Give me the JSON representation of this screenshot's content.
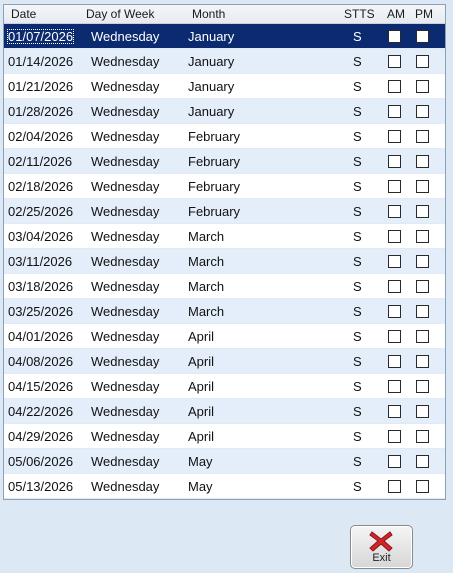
{
  "columns": {
    "date": "Date",
    "day_of_week": "Day of Week",
    "month": "Month",
    "stts": "STTS",
    "am": "AM",
    "pm": "PM"
  },
  "rows": [
    {
      "date": "01/07/2026",
      "day": "Wednesday",
      "month": "January",
      "stts": "S",
      "am": false,
      "pm": false,
      "selected": true
    },
    {
      "date": "01/14/2026",
      "day": "Wednesday",
      "month": "January",
      "stts": "S",
      "am": false,
      "pm": false
    },
    {
      "date": "01/21/2026",
      "day": "Wednesday",
      "month": "January",
      "stts": "S",
      "am": false,
      "pm": false
    },
    {
      "date": "01/28/2026",
      "day": "Wednesday",
      "month": "January",
      "stts": "S",
      "am": false,
      "pm": false
    },
    {
      "date": "02/04/2026",
      "day": "Wednesday",
      "month": "February",
      "stts": "S",
      "am": false,
      "pm": false
    },
    {
      "date": "02/11/2026",
      "day": "Wednesday",
      "month": "February",
      "stts": "S",
      "am": false,
      "pm": false
    },
    {
      "date": "02/18/2026",
      "day": "Wednesday",
      "month": "February",
      "stts": "S",
      "am": false,
      "pm": false
    },
    {
      "date": "02/25/2026",
      "day": "Wednesday",
      "month": "February",
      "stts": "S",
      "am": false,
      "pm": false
    },
    {
      "date": "03/04/2026",
      "day": "Wednesday",
      "month": "March",
      "stts": "S",
      "am": false,
      "pm": false
    },
    {
      "date": "03/11/2026",
      "day": "Wednesday",
      "month": "March",
      "stts": "S",
      "am": false,
      "pm": false
    },
    {
      "date": "03/18/2026",
      "day": "Wednesday",
      "month": "March",
      "stts": "S",
      "am": false,
      "pm": false
    },
    {
      "date": "03/25/2026",
      "day": "Wednesday",
      "month": "March",
      "stts": "S",
      "am": false,
      "pm": false
    },
    {
      "date": "04/01/2026",
      "day": "Wednesday",
      "month": "April",
      "stts": "S",
      "am": false,
      "pm": false
    },
    {
      "date": "04/08/2026",
      "day": "Wednesday",
      "month": "April",
      "stts": "S",
      "am": false,
      "pm": false
    },
    {
      "date": "04/15/2026",
      "day": "Wednesday",
      "month": "April",
      "stts": "S",
      "am": false,
      "pm": false
    },
    {
      "date": "04/22/2026",
      "day": "Wednesday",
      "month": "April",
      "stts": "S",
      "am": false,
      "pm": false
    },
    {
      "date": "04/29/2026",
      "day": "Wednesday",
      "month": "April",
      "stts": "S",
      "am": false,
      "pm": false
    },
    {
      "date": "05/06/2026",
      "day": "Wednesday",
      "month": "May",
      "stts": "S",
      "am": false,
      "pm": false
    },
    {
      "date": "05/13/2026",
      "day": "Wednesday",
      "month": "May",
      "stts": "S",
      "am": false,
      "pm": false
    }
  ],
  "exit_button": {
    "label": "Exit",
    "icon": "red-x-icon"
  },
  "colors": {
    "selected_row": "#0b2a6f",
    "alt_row": "#e4eefb",
    "background": "#dde8f5",
    "exit_icon": "#d0262a"
  }
}
